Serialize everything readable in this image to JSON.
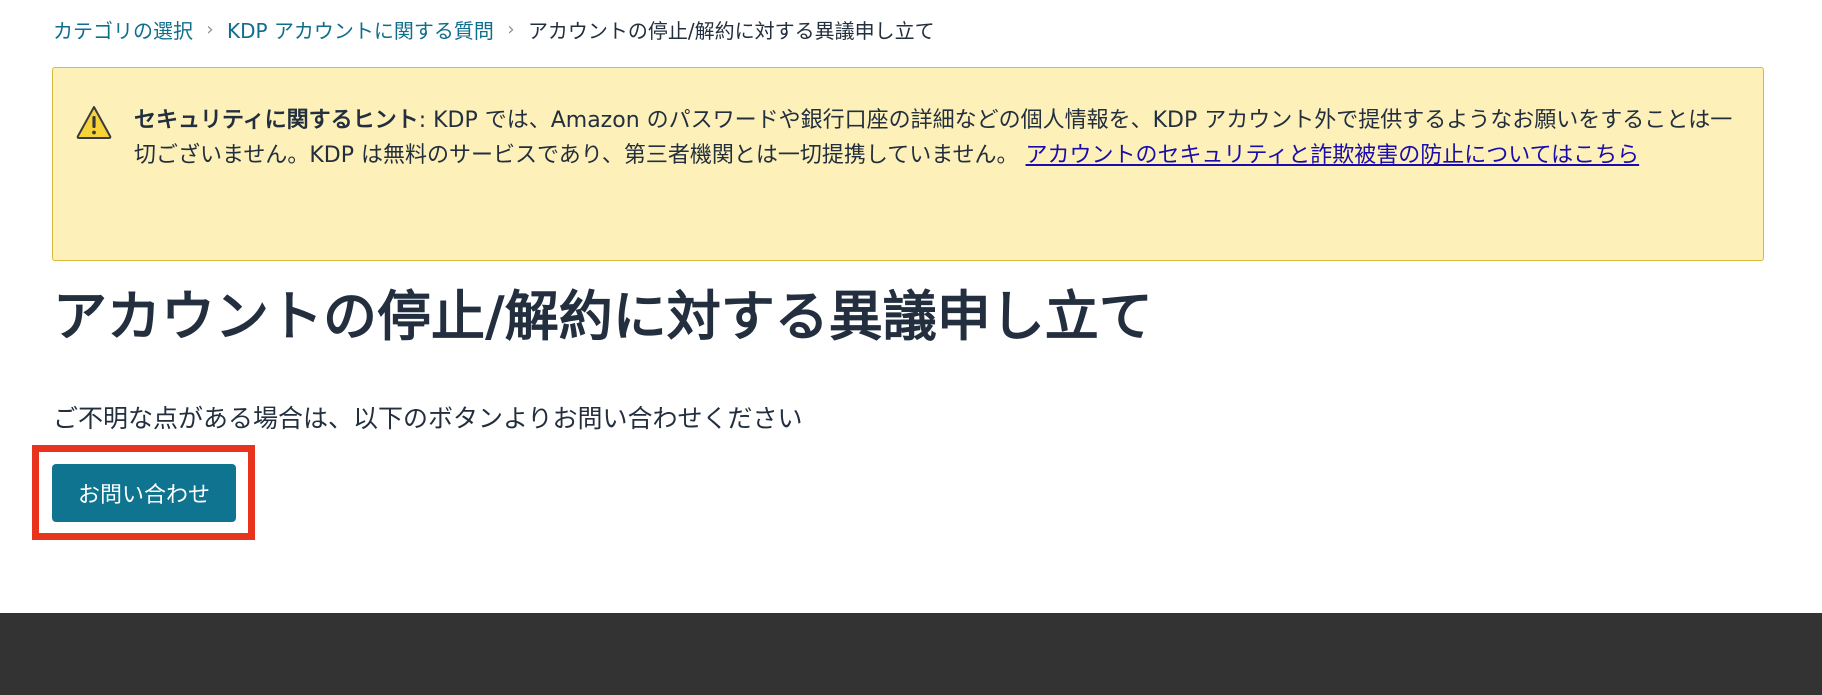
{
  "breadcrumb": {
    "items": [
      {
        "label": "カテゴリの選択"
      },
      {
        "label": "KDP アカウントに関する質問"
      }
    ],
    "current": "アカウントの停止/解約に対する異議申し立て",
    "separator": "›"
  },
  "alert": {
    "icon": "warning-icon",
    "heading": "セキュリティに関するヒント",
    "body": ": KDP では、Amazon のパスワードや銀行口座の詳細などの個人情報を、KDP アカウント外で提供するようなお願いをすることは一切ございません。KDP は無料のサービスであり、第三者機関とは一切提携していません。 ",
    "link_text": "アカウントのセキュリティと詐欺被害の防止についてはこちら",
    "background_color": "#fdf1b9",
    "border_color": "#d6bb3e"
  },
  "main": {
    "title": "アカウントの停止/解約に対する異議申し立て",
    "help_text": "ご不明な点がある場合は、以下のボタンよりお問い合わせください",
    "contact_button_label": "お問い合わせ"
  },
  "colors": {
    "link": "#0f6e8c",
    "button": "#0f7490",
    "highlight": "#e8341c",
    "footer": "#333333"
  }
}
